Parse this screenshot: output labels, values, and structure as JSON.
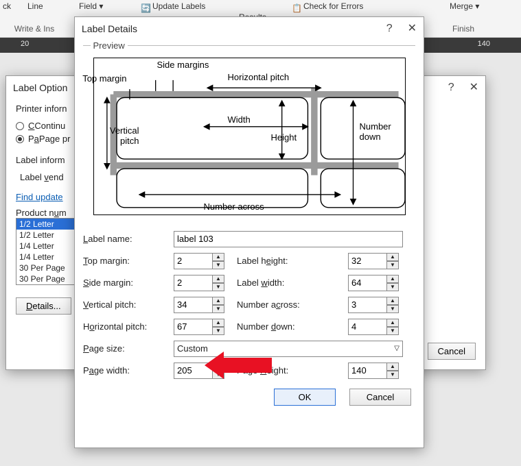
{
  "ribbon": {
    "btns": {
      "ck": "ck",
      "line": "Line",
      "field": "Field",
      "update_labels": "Update Labels",
      "results": "Results",
      "check_errors": "Check for Errors",
      "merge": "Merge",
      "finish": "Finish"
    },
    "group_write": "Write & Ins"
  },
  "ruler": {
    "left_tick": "20",
    "right_tick": "140"
  },
  "label_options": {
    "title": "Label Option",
    "printer_heading": "Printer inforn",
    "radio_continuous": "Continu",
    "radio_page": "Page pr",
    "label_inform": "Label inform",
    "label_vendor": "Label vend",
    "find_updates": "Find update",
    "product_num": "Product num",
    "products": [
      "1/2 Letter",
      "1/2 Letter",
      "1/4 Letter",
      "1/4 Letter",
      "30 Per Page",
      "30 Per Page"
    ],
    "details_btn": "Details...",
    "cancel_btn": "Cancel",
    "help": "?",
    "close": "✕"
  },
  "details": {
    "title": "Label Details",
    "help": "?",
    "close": "✕",
    "preview_legend": "Preview",
    "diagram": {
      "side_margins": "Side margins",
      "top_margin": "Top margin",
      "horizontal_pitch": "Horizontal pitch",
      "vertical_pitch": "Vertical pitch",
      "width": "Width",
      "height": "Height",
      "number_down": "Number down",
      "number_across": "Number across"
    },
    "fields": {
      "label_name_lbl": "Label name:",
      "label_name_val": "label 103",
      "top_margin_lbl": "Top margin:",
      "top_margin_val": "2",
      "side_margin_lbl": "Side margin:",
      "side_margin_val": "2",
      "vertical_pitch_lbl": "Vertical pitch:",
      "vertical_pitch_val": "34",
      "horizontal_pitch_lbl": "Horizontal pitch:",
      "horizontal_pitch_val": "67",
      "label_height_lbl": "Label height:",
      "label_height_val": "32",
      "label_width_lbl": "Label width:",
      "label_width_val": "64",
      "number_across_lbl": "Number across:",
      "number_across_val": "3",
      "number_down_lbl": "Number down:",
      "number_down_val": "4",
      "page_size_lbl": "Page size:",
      "page_size_val": "Custom",
      "page_width_lbl": "Page width:",
      "page_width_val": "205",
      "page_height_lbl": "Page Height:",
      "page_height_val": "140"
    },
    "ok": "OK",
    "cancel": "Cancel"
  }
}
